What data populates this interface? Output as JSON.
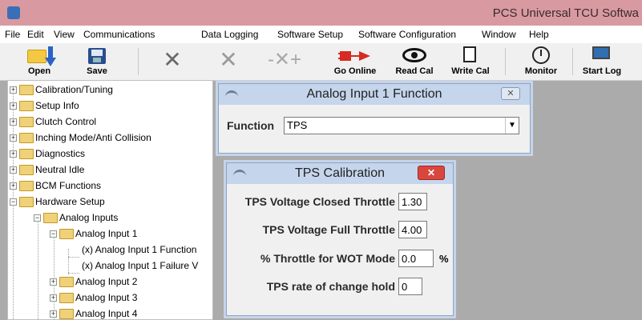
{
  "window": {
    "title": "PCS Universal TCU Softwa"
  },
  "menu": [
    "File",
    "Edit",
    "View",
    "Communications",
    "Data Logging",
    "Software Setup",
    "Software Configuration",
    "Window",
    "Help"
  ],
  "toolbar": {
    "open": "Open",
    "save": "Save",
    "go_online": "Go Online",
    "read_cal": "Read Cal",
    "write_cal": "Write Cal",
    "monitor": "Monitor",
    "start_log": "Start Log"
  },
  "tree": [
    {
      "label": "Calibration/Tuning",
      "expander": "+"
    },
    {
      "label": "Setup Info",
      "expander": "+"
    },
    {
      "label": "Clutch Control",
      "expander": "+"
    },
    {
      "label": "Inching Mode/Anti Collision",
      "expander": "+"
    },
    {
      "label": "Diagnostics",
      "expander": "+"
    },
    {
      "label": "Neutral Idle",
      "expander": "+"
    },
    {
      "label": "BCM Functions",
      "expander": "+"
    },
    {
      "label": "Hardware Setup",
      "expander": "−"
    },
    {
      "label": "Analog Inputs",
      "expander": "−"
    },
    {
      "label": "Analog Input 1",
      "expander": "−"
    },
    {
      "label": "(x) Analog Input 1 Function"
    },
    {
      "label": "(x) Analog Input 1 Failure V"
    },
    {
      "label": "Analog Input 2",
      "expander": "+"
    },
    {
      "label": "Analog Input 3",
      "expander": "+"
    },
    {
      "label": "Analog Input 4",
      "expander": "+"
    }
  ],
  "function_dialog": {
    "title": "Analog Input 1 Function",
    "label": "Function",
    "value": "TPS"
  },
  "tps_dialog": {
    "title": "TPS Calibration",
    "fields": [
      {
        "label": "TPS Voltage Closed Throttle",
        "value": "1.30"
      },
      {
        "label": "TPS Voltage Full Throttle",
        "value": "4.00"
      },
      {
        "label": "% Throttle for WOT Mode",
        "value": "0.0",
        "unit": "%"
      },
      {
        "label": "TPS rate of change hold",
        "value": "0"
      }
    ]
  },
  "colors": {
    "titlebar": "#d89aa0",
    "dialog_title": "#c5d5ec",
    "close_red": "#d9463e"
  }
}
